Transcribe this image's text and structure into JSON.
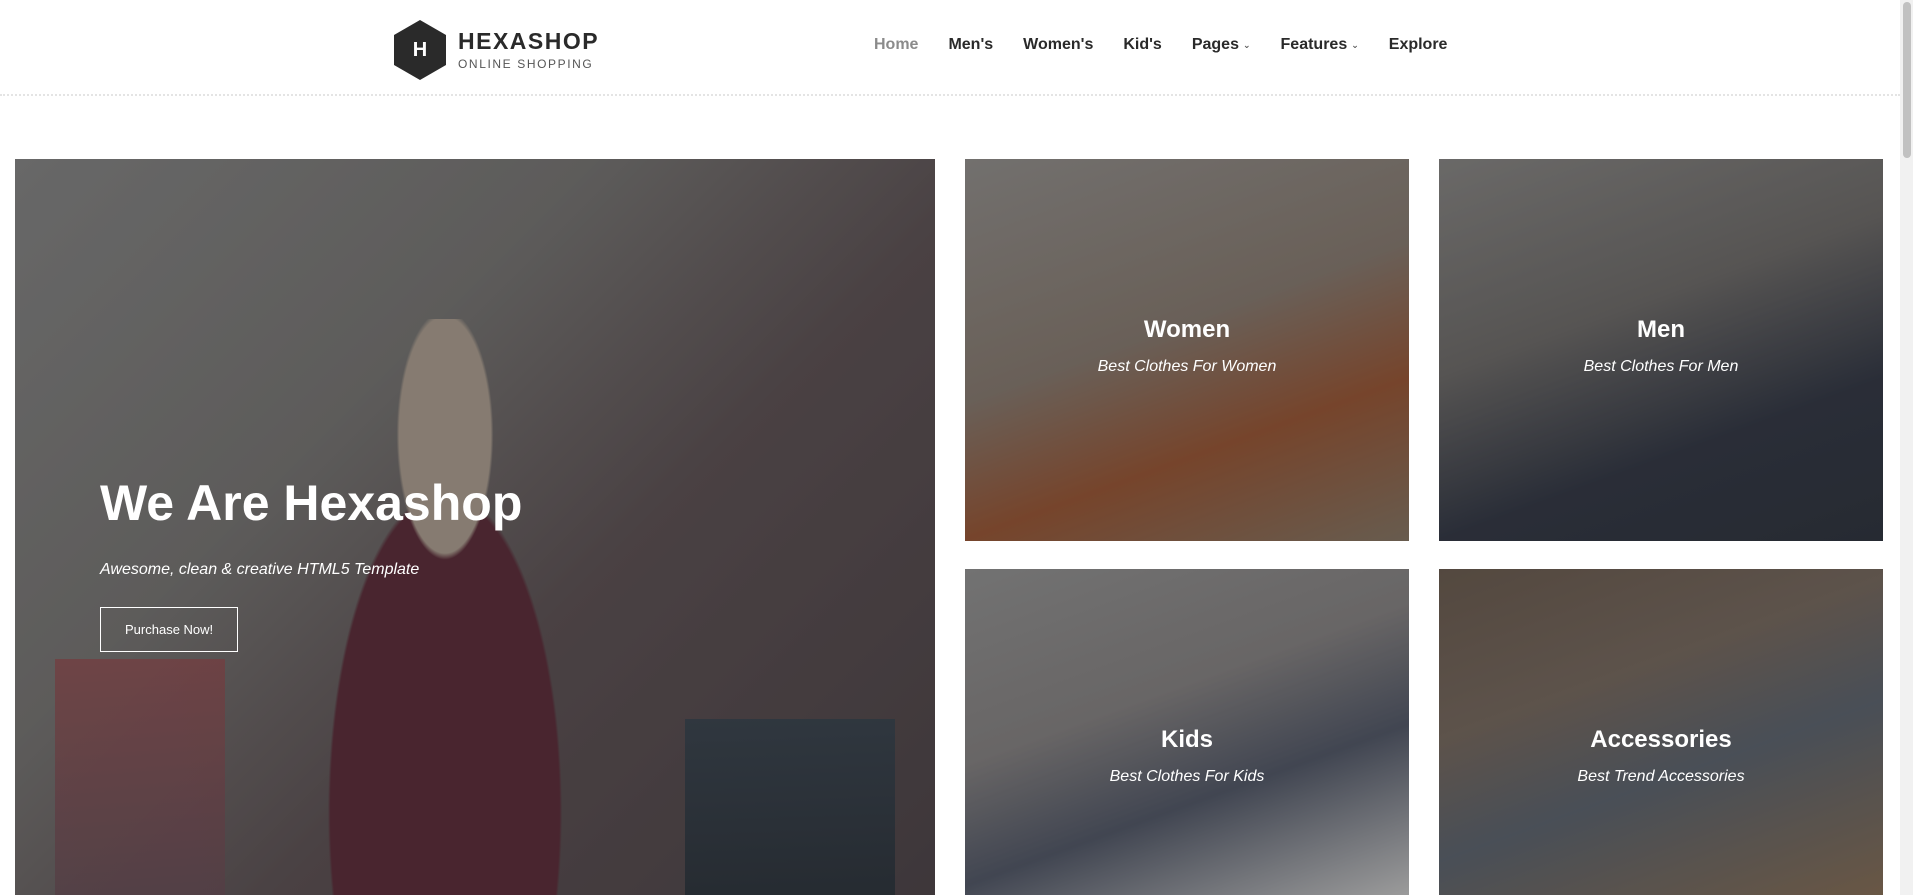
{
  "brand": {
    "logo_letter": "H",
    "name": "HEXASHOP",
    "tagline": "ONLINE SHOPPING"
  },
  "nav": {
    "items": [
      {
        "label": "Home",
        "active": true
      },
      {
        "label": "Men's"
      },
      {
        "label": "Women's"
      },
      {
        "label": "Kid's"
      },
      {
        "label": "Pages",
        "dropdown": true
      },
      {
        "label": "Features",
        "dropdown": true
      },
      {
        "label": "Explore"
      }
    ]
  },
  "hero": {
    "title": "We Are Hexashop",
    "subtitle": "Awesome, clean & creative HTML5 Template",
    "button_label": "Purchase Now!"
  },
  "categories": [
    {
      "title": "Women",
      "subtitle": "Best Clothes For Women"
    },
    {
      "title": "Men",
      "subtitle": "Best Clothes For Men"
    },
    {
      "title": "Kids",
      "subtitle": "Best Clothes For Kids"
    },
    {
      "title": "Accessories",
      "subtitle": "Best Trend Accessories"
    }
  ],
  "colors": {
    "text_dark": "#2a2a2a",
    "nav_active": "#8b8b8b",
    "white": "#ffffff"
  }
}
